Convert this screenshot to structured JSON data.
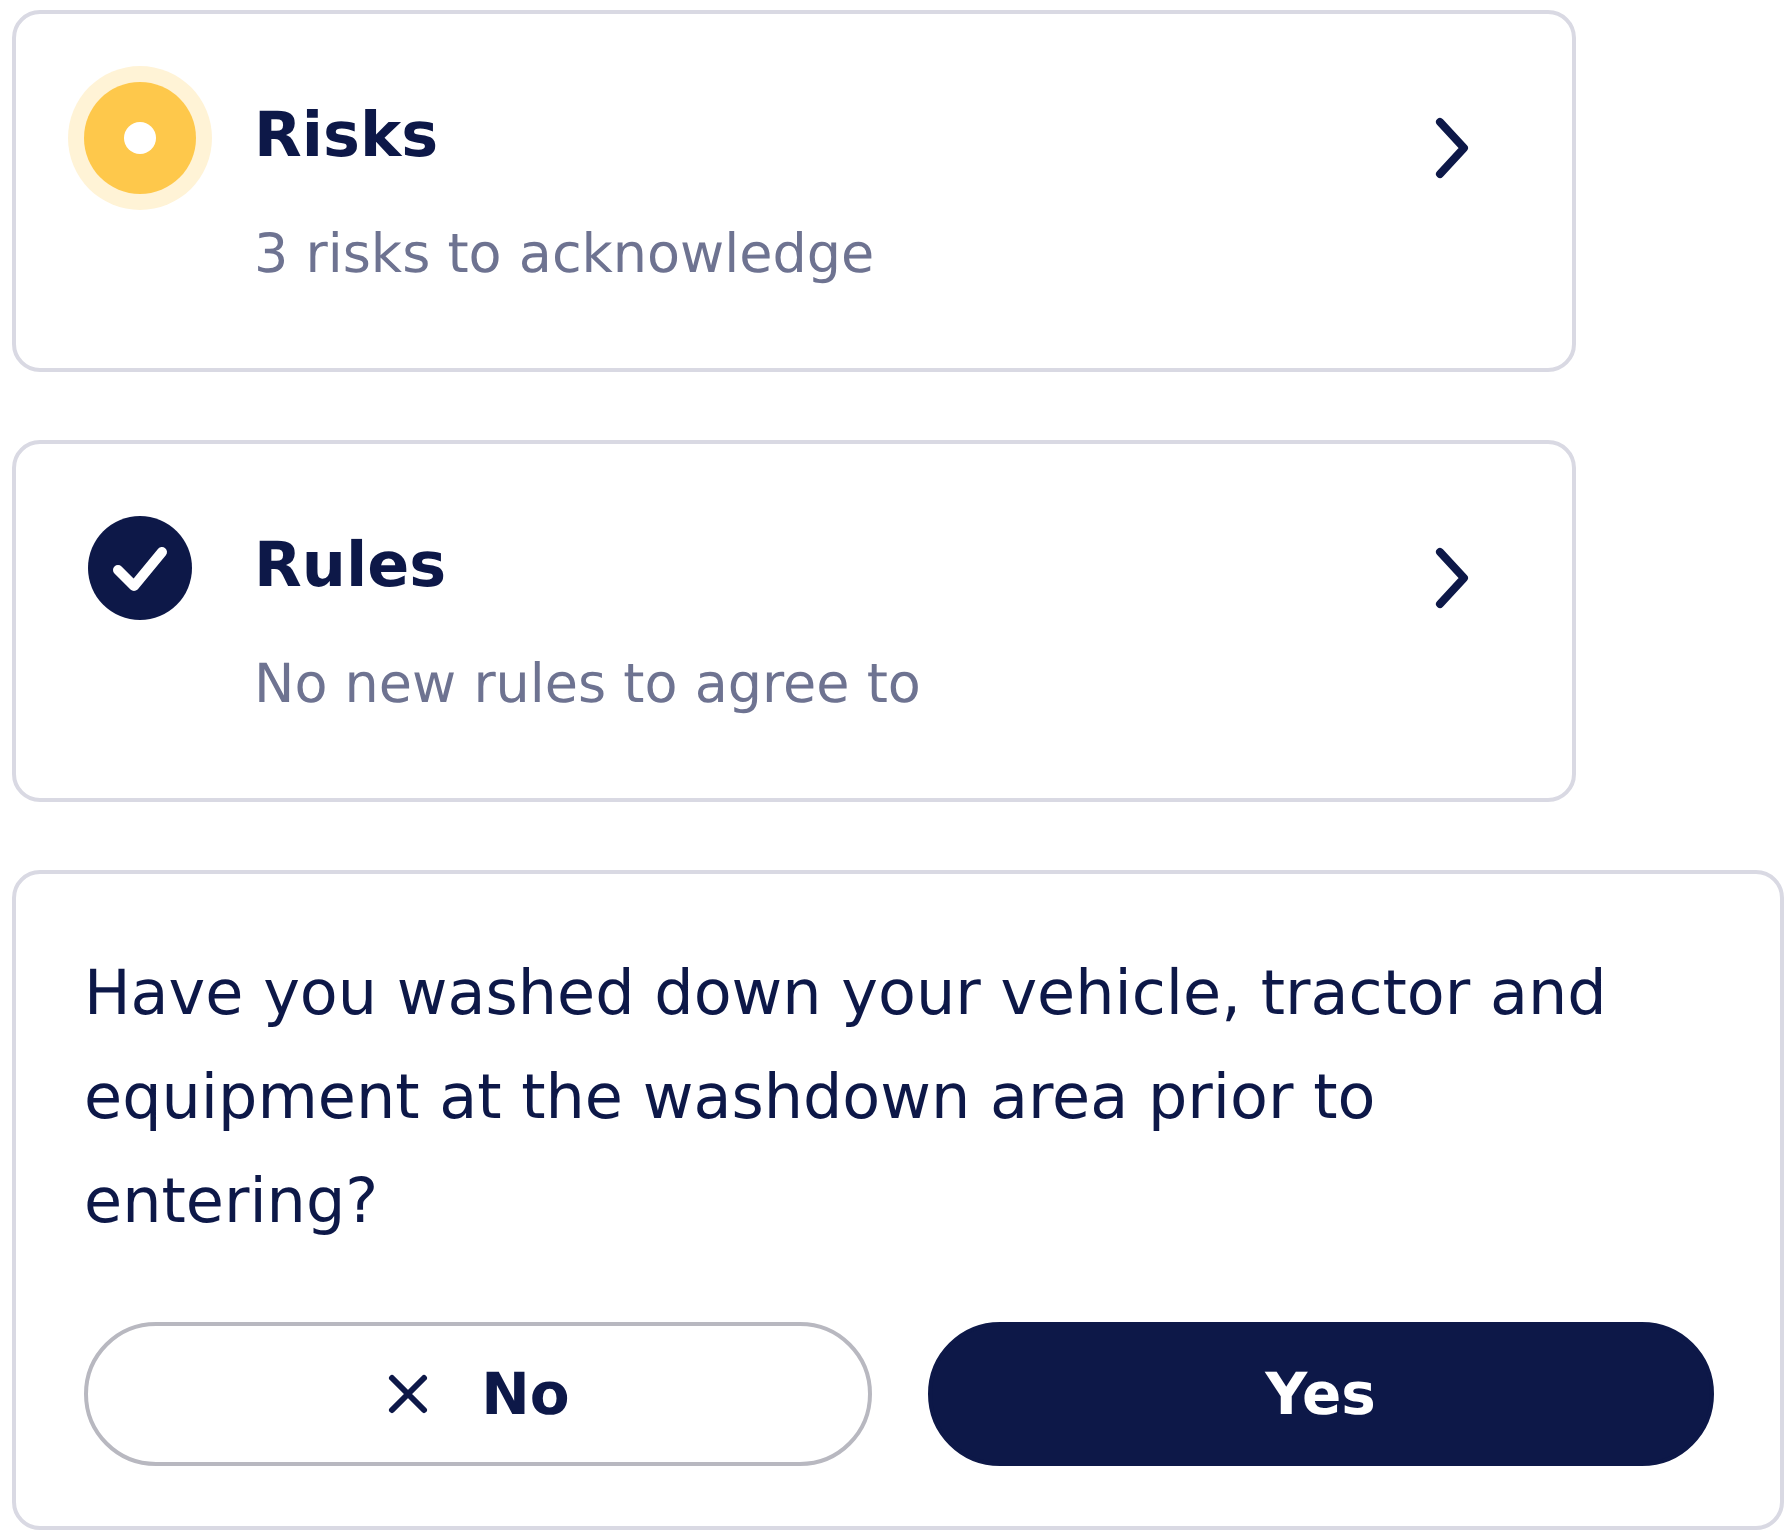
{
  "items": [
    {
      "title": "Risks",
      "subtitle": "3 risks to acknowledge",
      "done": false
    },
    {
      "title": "Rules",
      "subtitle": "No new rules to agree to",
      "done": true
    }
  ],
  "question": {
    "text": "Have you washed down your vehicle, tractor and equipment at the washdown area prior to entering?",
    "buttons": [
      {
        "label": "No",
        "kind": "outline"
      },
      {
        "label": "Yes",
        "kind": "filled"
      }
    ]
  }
}
